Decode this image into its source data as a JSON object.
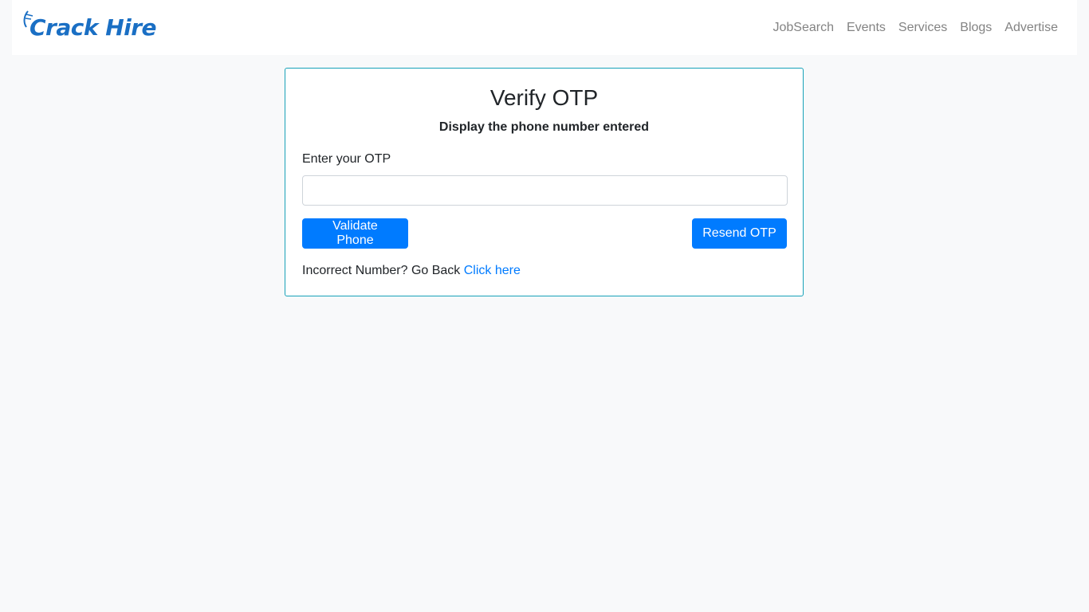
{
  "brand": {
    "name": "Crack Hire",
    "color": "#1a6fc4"
  },
  "nav": {
    "items": [
      {
        "label": "JobSearch"
      },
      {
        "label": "Events"
      },
      {
        "label": "Services"
      },
      {
        "label": "Blogs"
      },
      {
        "label": "Advertise"
      }
    ]
  },
  "verify": {
    "title": "Verify OTP",
    "subtitle": "Display the phone number entered",
    "otp_label": "Enter your OTP",
    "otp_value": "",
    "validate_label": "Validate Phone",
    "resend_label": "Resend OTP",
    "go_back_text": "Incorrect Number? Go Back",
    "go_back_link": "Click here"
  },
  "colors": {
    "accent": "#007bff",
    "card_border": "#17a2b8",
    "background": "#f8f9fa"
  }
}
